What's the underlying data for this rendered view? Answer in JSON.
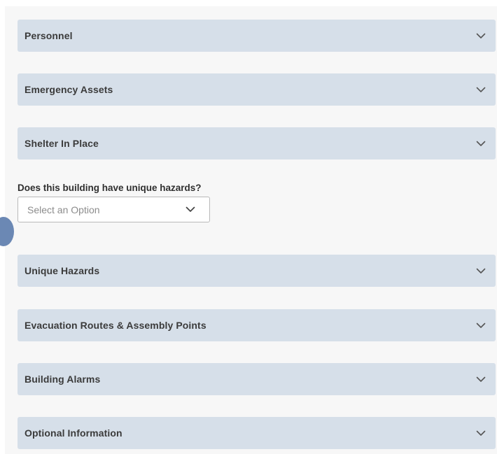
{
  "sections": [
    {
      "title": "Personnel"
    },
    {
      "title": "Emergency Assets"
    },
    {
      "title": "Shelter In Place"
    },
    {
      "title": "Unique Hazards"
    },
    {
      "title": "Evacuation Routes & Assembly Points"
    },
    {
      "title": "Building Alarms"
    },
    {
      "title": "Optional Information"
    }
  ],
  "hazards_question": {
    "label": "Does this building have unique hazards?",
    "placeholder": "Select an Option",
    "icon": "chevron-down-icon"
  },
  "colors": {
    "accordion_bg": "#d6dfe9",
    "page_bg": "#f7f7f7",
    "handle": "#6b88b4"
  }
}
